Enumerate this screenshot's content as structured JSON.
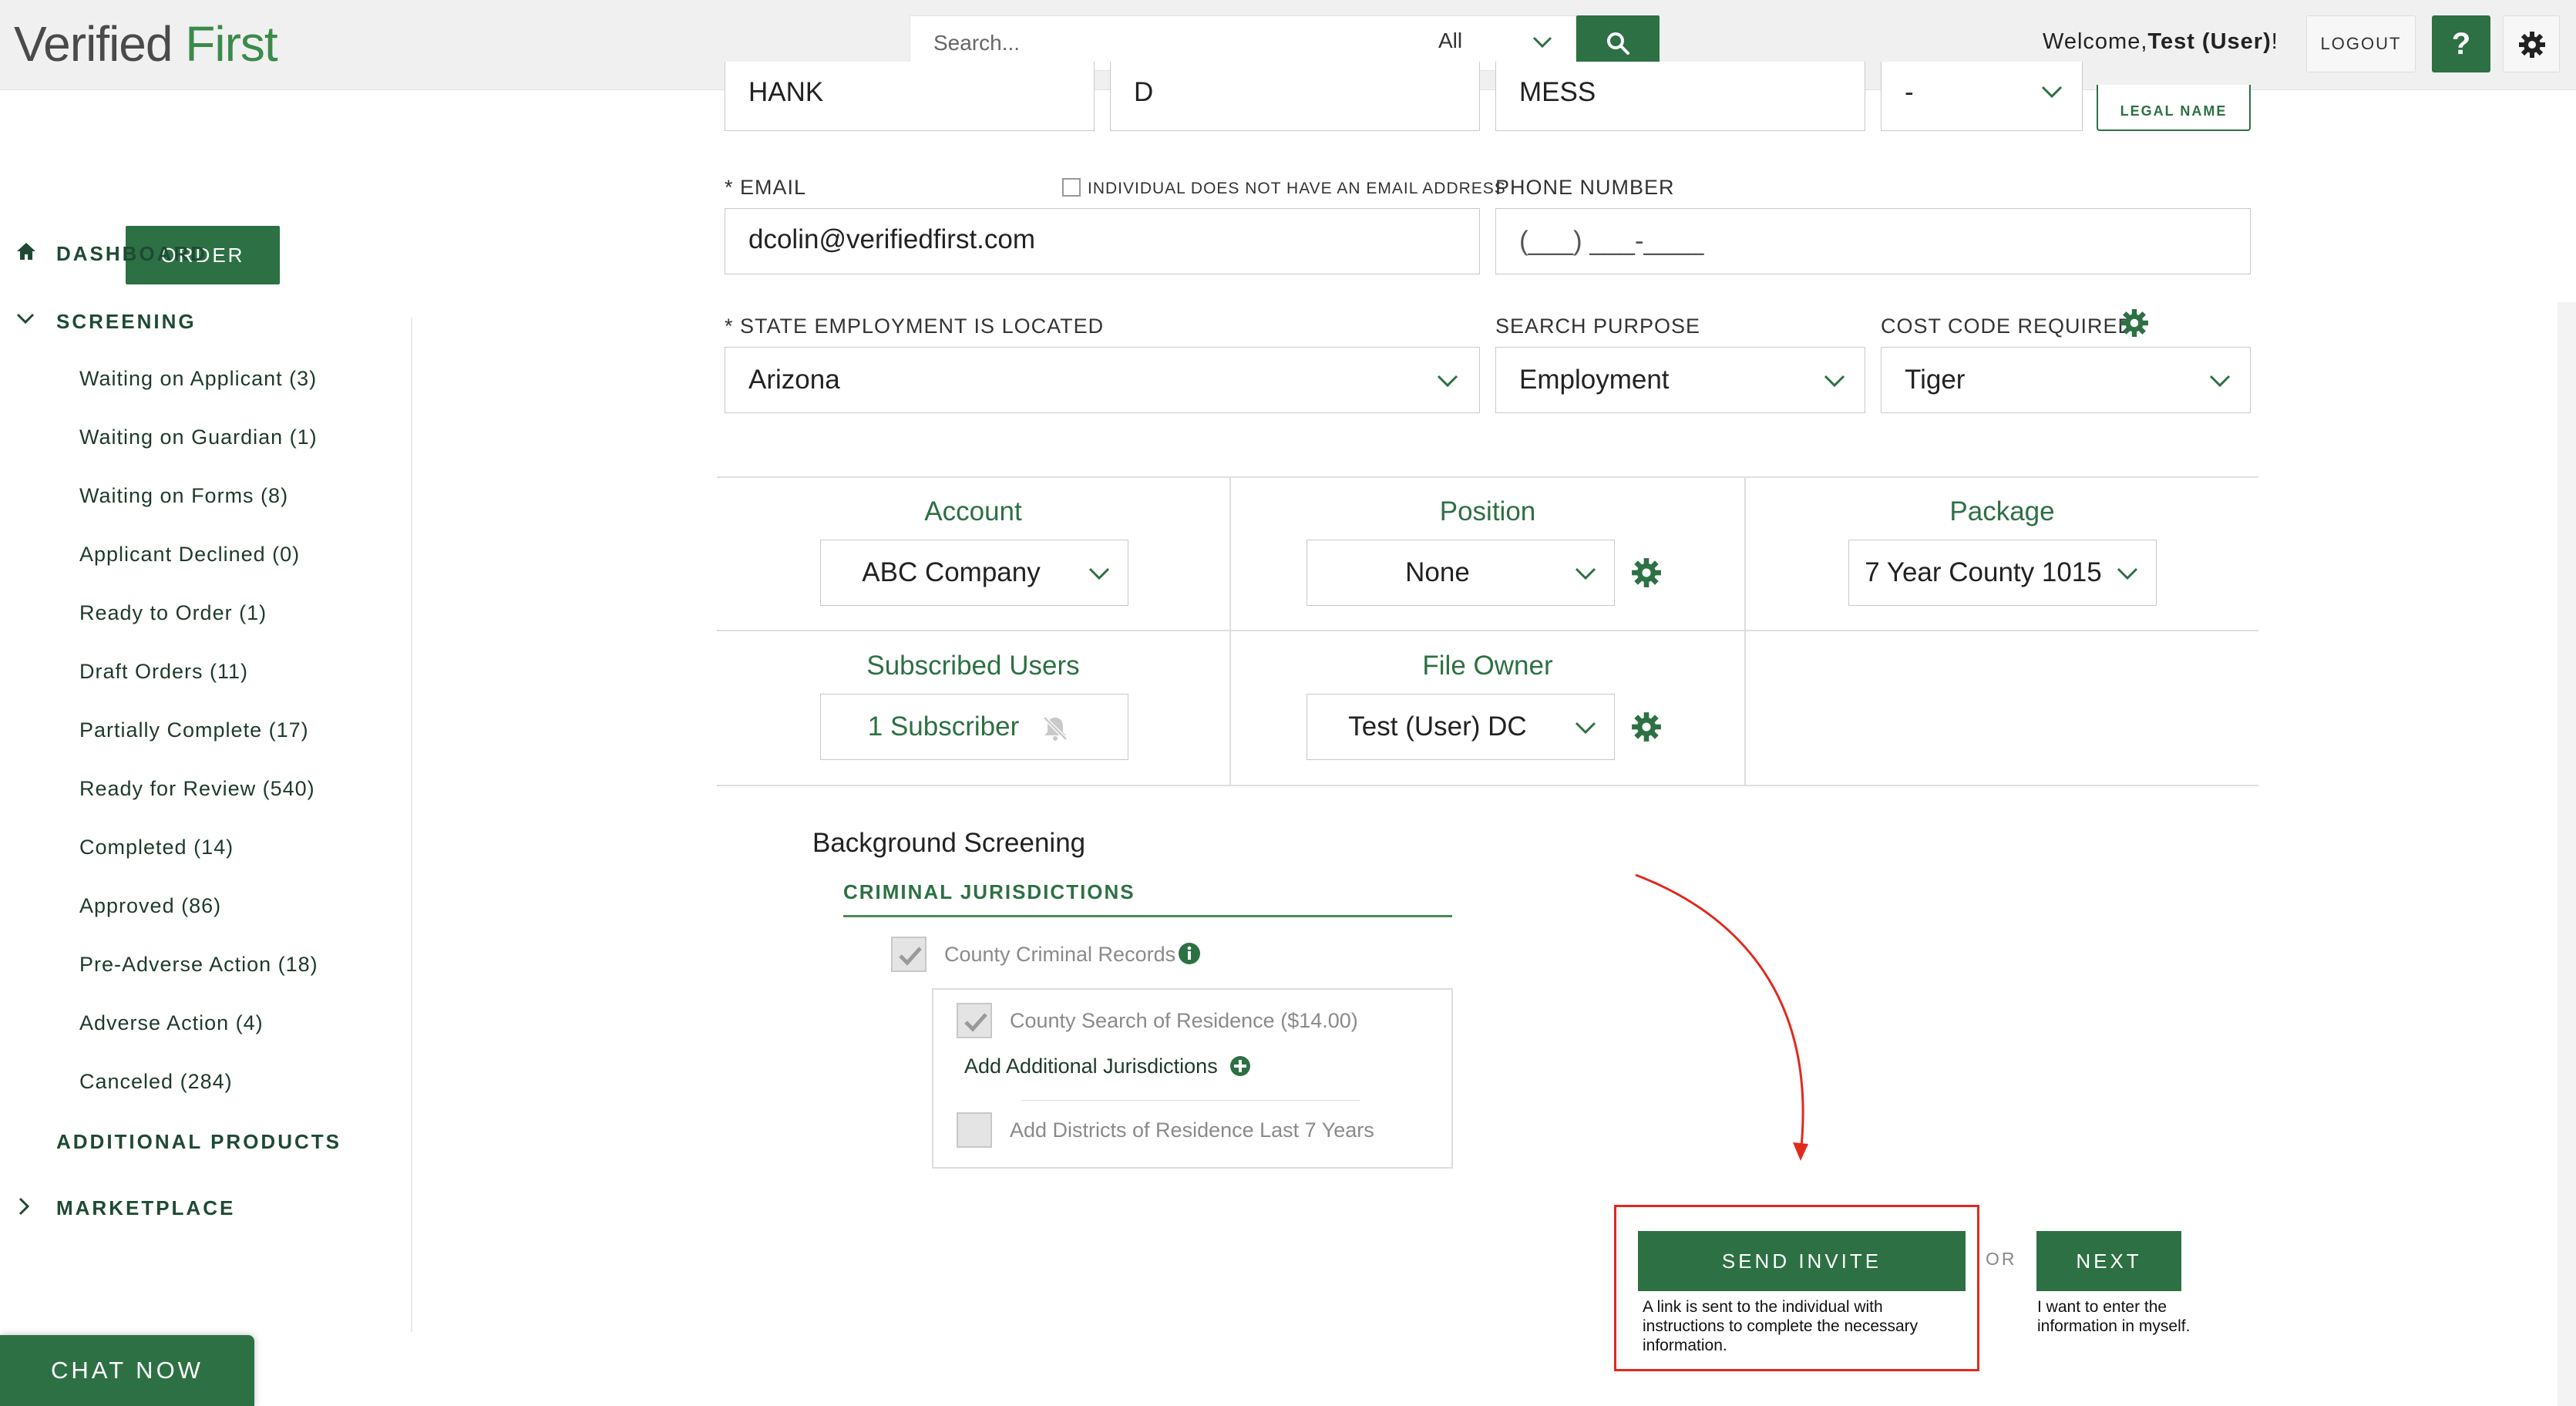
{
  "header": {
    "logo_part1": "Verified",
    "logo_part2": "First",
    "search_placeholder": "Search...",
    "search_scope": "All",
    "welcome_prefix": "Welcome,",
    "welcome_user": "Test (User)",
    "welcome_suffix": "!",
    "logout_label": "LOGOUT",
    "help_label": "?"
  },
  "sidebar": {
    "order_label": "ORDER",
    "dashboard_label": "DASHBOARD",
    "screening_label": "SCREENING",
    "items": [
      {
        "label": "Waiting on Applicant (3)"
      },
      {
        "label": "Waiting on Guardian (1)"
      },
      {
        "label": "Waiting on Forms (8)"
      },
      {
        "label": "Applicant Declined (0)"
      },
      {
        "label": "Ready to Order (1)"
      },
      {
        "label": "Draft Orders (11)"
      },
      {
        "label": "Partially Complete (17)"
      },
      {
        "label": "Ready for Review (540)"
      },
      {
        "label": "Completed (14)"
      },
      {
        "label": "Approved (86)"
      },
      {
        "label": "Pre-Adverse Action (18)"
      },
      {
        "label": "Adverse Action (4)"
      },
      {
        "label": "Canceled (284)"
      }
    ],
    "additional_products_label": "ADDITIONAL PRODUCTS",
    "marketplace_label": "MARKETPLACE",
    "chat_label": "CHAT NOW"
  },
  "form": {
    "first_name": "HANK",
    "middle_name": "D",
    "last_name": "MESS",
    "suffix": "-",
    "legal_name_label": "LEGAL NAME",
    "email_label": "* EMAIL",
    "no_email_label": "INDIVIDUAL DOES NOT HAVE AN EMAIL ADDRESS",
    "email_value": "dcolin@verifiedfirst.com",
    "phone_label": "PHONE NUMBER",
    "phone_placeholder": "(___) ___-____",
    "state_label": "* STATE EMPLOYMENT IS LOCATED",
    "state_value": "Arizona",
    "purpose_label": "SEARCH PURPOSE",
    "purpose_value": "Employment",
    "costcode_label": "COST CODE REQUIRED",
    "costcode_value": "Tiger"
  },
  "order_grid": {
    "account_title": "Account",
    "account_value": "ABC Company",
    "position_title": "Position",
    "position_value": "None",
    "package_title": "Package",
    "package_value": "7 Year County 1015",
    "subscribed_title": "Subscribed Users",
    "subscribed_value": "1 Subscriber",
    "owner_title": "File Owner",
    "owner_value": "Test (User) DC"
  },
  "screening": {
    "section_title": "Background Screening",
    "criminal_title": "CRIMINAL JURISDICTIONS",
    "county_records": "County Criminal Records",
    "county_search": "County Search of Residence ($14.00)",
    "add_jurisdictions": "Add Additional Jurisdictions",
    "add_districts": "Add Districts of Residence Last 7 Years"
  },
  "actions": {
    "send_invite_label": "SEND INVITE",
    "send_invite_help": "A link is sent to the individual with instructions to complete the necessary information.",
    "or_label": "OR",
    "next_label": "NEXT",
    "next_help": "I want to enter the information in myself."
  },
  "colors": {
    "brand_green": "#2d7044",
    "annotation_red": "#e02a1e"
  }
}
